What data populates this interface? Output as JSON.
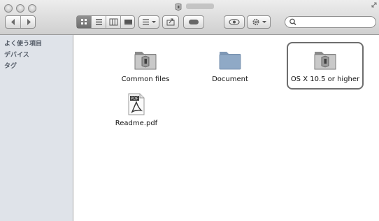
{
  "window": {
    "title_icon": "app-icon"
  },
  "toolbar": {
    "back_icon": "back-arrow-icon",
    "forward_icon": "forward-arrow-icon",
    "view_icons": [
      "icon-view-icon",
      "list-view-icon",
      "column-view-icon",
      "coverflow-view-icon"
    ],
    "arrange_icon": "arrange-menu-icon",
    "share_icon": "share-icon",
    "tag_icon": "tag-icon",
    "quicklook_icon": "eye-icon",
    "action_icon": "gear-icon",
    "search_placeholder": ""
  },
  "sidebar": {
    "items": [
      {
        "label": "よく使う項目"
      },
      {
        "label": "デバイス"
      },
      {
        "label": "タグ"
      }
    ]
  },
  "files": [
    {
      "label": "Common files",
      "icon": "folder-with-app-icon"
    },
    {
      "label": "Document",
      "icon": "folder-icon"
    },
    {
      "label": "OS X 10.5 or higher",
      "icon": "folder-with-app-icon",
      "selected": true
    },
    {
      "label": "Readme.pdf",
      "icon": "pdf-icon",
      "badge": "PDF"
    }
  ],
  "colors": {
    "sidebar_bg": "#dfe3e9",
    "folder_blue": "#8fa9c6",
    "selection_border": "#6e6e6e"
  }
}
